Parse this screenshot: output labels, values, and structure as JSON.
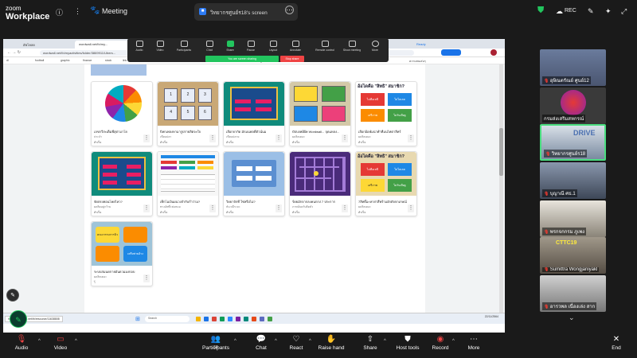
{
  "app": {
    "brand_top": "zoom",
    "brand_bottom": "Workplace",
    "meeting_label": "Meeting",
    "share_title": "วิทยากรศูนย์ร18's screen",
    "rec_label": "REC"
  },
  "browser": {
    "tabs": [
      "อัพโหลด",
      "wordwall.net/th/my...",
      "Ready"
    ],
    "url": "wordwall.net/th/myactivities/folder/3869911/Ubers..."
  },
  "bookmarks": [
    "dl",
    "football",
    "graphic",
    "finance",
    "stock",
    "link",
    "twitter",
    "api",
    "New folder",
    "api2",
    "api3",
    "api4",
    "run",
    "หลักสูตร",
    "ต่อตั้งเขตพัก",
    "ที่มีข้อเนอร์เพอร์ซี",
    "Zoom studio",
    "ความสนเล่นๆ"
  ],
  "controls": {
    "items": [
      "Audio",
      "Video",
      "Participants",
      "Chat",
      "Share",
      "Pause",
      "Layout",
      "Annotate",
      "Remote control",
      "Show meeting",
      "More"
    ],
    "share_label": "You are screen sharing",
    "stop_label": "Stop share",
    "participants_count": "54"
  },
  "cards": [
    {
      "title": "เลขกวีสะเต็มพี่สุด่ามาโย",
      "sub": "ประจำ",
      "stat": "สำเร็จ"
    },
    {
      "title": "บิหกเพลงหามารูปรายสิตจะใจ",
      "sub": "เขียนปลา",
      "stat": "สำเร็จ"
    },
    {
      "title": "เลือกจากัด มักมนพลดี่ตัวน์นม",
      "sub": "เขียนปลาย",
      "stat": "สำเร็จ"
    },
    {
      "title": "บัปบงทฝ์ฝ์ค Wordwall... จุดแหลง...",
      "sub": "ผลลิตเคอะ",
      "stat": "สำเร็จ"
    },
    {
      "title": "เลือกอ้อฬมน่าพ่ำที่มนไค่ตาลีทร์",
      "sub": "ผลลิตเคอะ",
      "stat": "สำเร็จ"
    },
    {
      "title": "จัดตรงทอนโคยไหว?",
      "sub": "ผลติดอยู่กว้าม",
      "stat": "สำเร็จ"
    },
    {
      "title": "เท็กโมเงินผนวงจำกับก่ำว่าม?",
      "sub": "ทางอัพที่ะต่อหมอ",
      "stat": "สำเร็จ"
    },
    {
      "title": "วิดยาจักที่ ใช่หรือไม่?",
      "sub": "ห์นวณีระยะ",
      "stat": "สำเร็จ"
    },
    {
      "title": "ร์ดยมักจากลงคนกกง่ 7 ประการ",
      "sub": "ภาพมั่นยรับติดตัว",
      "stat": "สำเร็จ"
    },
    {
      "title": "7สิทธิ์มะหาย่าสี่พร้ามอักตัจกกเกษณ์",
      "sub": "ผลลิตเคอะ",
      "stat": "สำเร็จ"
    },
    {
      "title": "ระบบสมนดกายอันดวมมงกอบ",
      "sub": "ผลลิตเคอะ",
      "stat": "ไ่"
    }
  ],
  "thumb_text": {
    "q_heading": "อ้อไดคือ \"สิทธิ\" สมาชิก?",
    "answer_a": "ไม่คือเหนี",
    "answer_b": "ไม่ไดเลย",
    "answer_c": "เสรีภาพ",
    "answer_d": "ไม่รับเลียฐ",
    "grid_numbers": [
      "1",
      "2",
      "3",
      "4",
      "5",
      "6"
    ],
    "orange_label": "คณะกรรมการนิวมาร์ค",
    "blue_label": "เครือข่ายอ้าง"
  },
  "taskbar": {
    "search": "Search",
    "time": "",
    "date": "22/11/2564"
  },
  "status_url": "https://wordwall.net/th/resource/11638808",
  "participants": [
    {
      "name": "อุษิณตรัณย์ ศูนย์12",
      "muted": true
    },
    {
      "name": "กรมส่งเสริมสหกรณ์",
      "muted": false
    },
    {
      "name": "วิทยากรศูนย์ร18",
      "muted": true,
      "speaking": true
    },
    {
      "name": "บุญาณี ศธ.1",
      "muted": true
    },
    {
      "name": "พรกจกกรม ภูเพง",
      "muted": true
    },
    {
      "name": "Sumittra Wongjaniyakl",
      "muted": true
    },
    {
      "name": "อารวพล เนื่องเล่ง สาก",
      "muted": true
    }
  ],
  "participant_tile_text": [
    "DRIVE",
    "CTTC19"
  ],
  "toolbar": {
    "items": [
      "Audio",
      "Video",
      "Participants",
      "Chat",
      "React",
      "Raise hand",
      "Share",
      "Host tools",
      "Record",
      "More",
      "End"
    ],
    "participants_count": "54"
  },
  "colors": {
    "accent_green": "#22c55e",
    "rec_red": "#ef4444",
    "card_purple": "#4a2b7a",
    "card_teal": "#0f8b7c",
    "zoom_bg": "#1a1a1a"
  }
}
